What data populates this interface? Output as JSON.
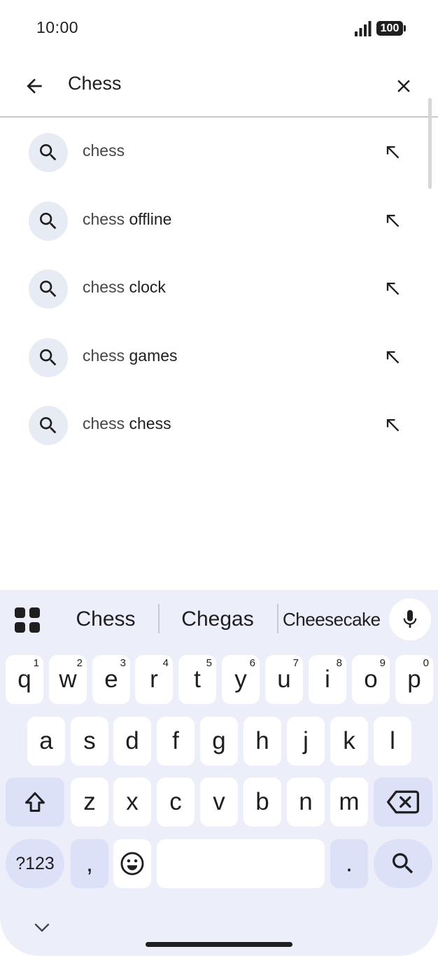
{
  "status_bar": {
    "time": "10:00",
    "battery": "100"
  },
  "search": {
    "query": "Chess",
    "back_icon": "arrow-back-icon",
    "clear_icon": "close-icon"
  },
  "suggestions": [
    {
      "prefix": "chess",
      "rest": ""
    },
    {
      "prefix": "chess",
      "rest": " offline"
    },
    {
      "prefix": "chess",
      "rest": " clock"
    },
    {
      "prefix": "chess",
      "rest": " games"
    },
    {
      "prefix": "chess",
      "rest": " chess"
    }
  ],
  "keyboard": {
    "word_suggestions": [
      "Chess",
      "Chegas",
      "Cheesecake"
    ],
    "row1": [
      {
        "key": "q",
        "hint": "1"
      },
      {
        "key": "w",
        "hint": "2"
      },
      {
        "key": "e",
        "hint": "3"
      },
      {
        "key": "r",
        "hint": "4"
      },
      {
        "key": "t",
        "hint": "5"
      },
      {
        "key": "y",
        "hint": "6"
      },
      {
        "key": "u",
        "hint": "7"
      },
      {
        "key": "i",
        "hint": "8"
      },
      {
        "key": "o",
        "hint": "9"
      },
      {
        "key": "p",
        "hint": "0"
      }
    ],
    "row2": [
      "a",
      "s",
      "d",
      "f",
      "g",
      "h",
      "j",
      "k",
      "l"
    ],
    "row3": [
      "z",
      "x",
      "c",
      "v",
      "b",
      "n",
      "m"
    ],
    "symbols_label": "?123",
    "comma": ",",
    "period": "."
  },
  "colors": {
    "keyboard_bg": "#eceef9",
    "modifier_key": "#dde1f8",
    "suggestion_icon_bg": "#e7ebf4"
  }
}
